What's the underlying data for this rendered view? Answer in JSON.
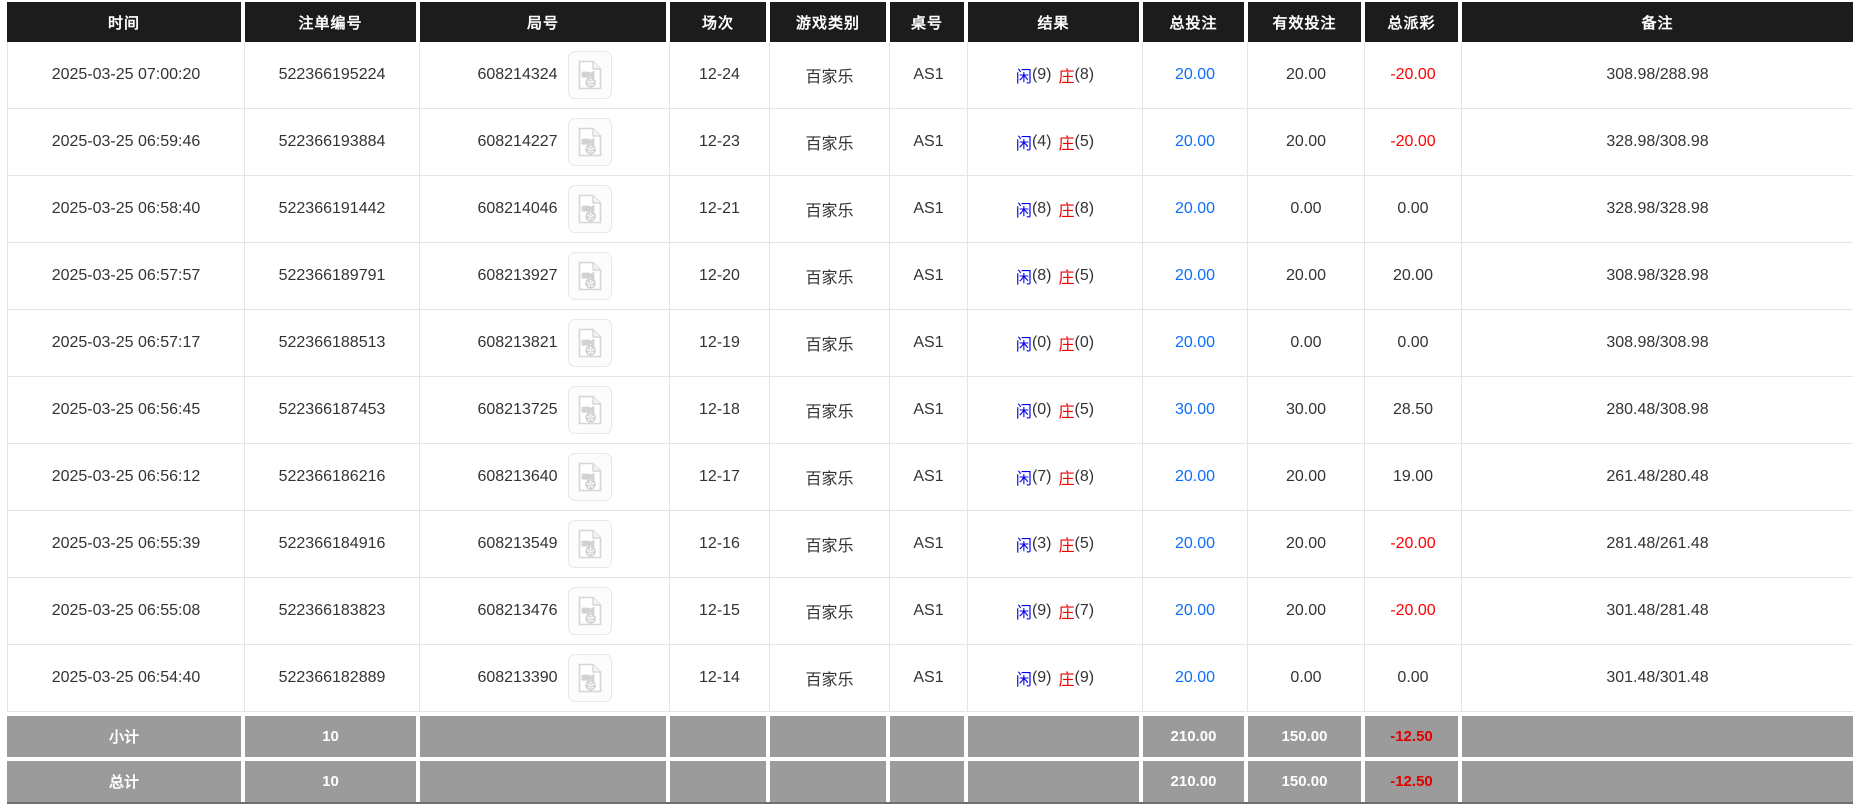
{
  "theme": {
    "header_bg": "#1c1c1c",
    "header_text": "#ffffff",
    "body_text": "#333333",
    "row_border": "#e4e4e4",
    "player_blue": "#0000ee",
    "banker_red": "#ee0000",
    "bet_blue": "#0d6efd",
    "negative_red": "#ff0000",
    "summary_bg": "#9b9b9b",
    "summary_text": "#ffffff",
    "summary_negative": "#e00000"
  },
  "table": {
    "columns": [
      {
        "key": "time",
        "label": "时间"
      },
      {
        "key": "bet_no",
        "label": "注单编号"
      },
      {
        "key": "round_no",
        "label": "局号"
      },
      {
        "key": "session",
        "label": "场次"
      },
      {
        "key": "game",
        "label": "游戏类别"
      },
      {
        "key": "table_no",
        "label": "桌号"
      },
      {
        "key": "result",
        "label": "结果"
      },
      {
        "key": "bet",
        "label": "总投注"
      },
      {
        "key": "valid",
        "label": "有效投注"
      },
      {
        "key": "payout",
        "label": "总派彩"
      },
      {
        "key": "remark",
        "label": "备注"
      }
    ],
    "result_labels": {
      "player": "闲",
      "banker": "庄"
    },
    "icons": {
      "round_video_button": "video-file-icon"
    },
    "rows": [
      {
        "time": "2025-03-25 07:00:20",
        "bet_no": "522366195224",
        "round_no": "608214324",
        "session": "12-24",
        "game": "百家乐",
        "table_no": "AS1",
        "player_score": "(9)",
        "banker_score": "(8)",
        "bet": "20.00",
        "valid": "20.00",
        "payout": "-20.00",
        "remark": "308.98/288.98"
      },
      {
        "time": "2025-03-25 06:59:46",
        "bet_no": "522366193884",
        "round_no": "608214227",
        "session": "12-23",
        "game": "百家乐",
        "table_no": "AS1",
        "player_score": "(4)",
        "banker_score": "(5)",
        "bet": "20.00",
        "valid": "20.00",
        "payout": "-20.00",
        "remark": "328.98/308.98"
      },
      {
        "time": "2025-03-25 06:58:40",
        "bet_no": "522366191442",
        "round_no": "608214046",
        "session": "12-21",
        "game": "百家乐",
        "table_no": "AS1",
        "player_score": "(8)",
        "banker_score": "(8)",
        "bet": "20.00",
        "valid": "0.00",
        "payout": "0.00",
        "remark": "328.98/328.98"
      },
      {
        "time": "2025-03-25 06:57:57",
        "bet_no": "522366189791",
        "round_no": "608213927",
        "session": "12-20",
        "game": "百家乐",
        "table_no": "AS1",
        "player_score": "(8)",
        "banker_score": "(5)",
        "bet": "20.00",
        "valid": "20.00",
        "payout": "20.00",
        "remark": "308.98/328.98"
      },
      {
        "time": "2025-03-25 06:57:17",
        "bet_no": "522366188513",
        "round_no": "608213821",
        "session": "12-19",
        "game": "百家乐",
        "table_no": "AS1",
        "player_score": "(0)",
        "banker_score": "(0)",
        "bet": "20.00",
        "valid": "0.00",
        "payout": "0.00",
        "remark": "308.98/308.98"
      },
      {
        "time": "2025-03-25 06:56:45",
        "bet_no": "522366187453",
        "round_no": "608213725",
        "session": "12-18",
        "game": "百家乐",
        "table_no": "AS1",
        "player_score": "(0)",
        "banker_score": "(5)",
        "bet": "30.00",
        "valid": "30.00",
        "payout": "28.50",
        "remark": "280.48/308.98"
      },
      {
        "time": "2025-03-25 06:56:12",
        "bet_no": "522366186216",
        "round_no": "608213640",
        "session": "12-17",
        "game": "百家乐",
        "table_no": "AS1",
        "player_score": "(7)",
        "banker_score": "(8)",
        "bet": "20.00",
        "valid": "20.00",
        "payout": "19.00",
        "remark": "261.48/280.48"
      },
      {
        "time": "2025-03-25 06:55:39",
        "bet_no": "522366184916",
        "round_no": "608213549",
        "session": "12-16",
        "game": "百家乐",
        "table_no": "AS1",
        "player_score": "(3)",
        "banker_score": "(5)",
        "bet": "20.00",
        "valid": "20.00",
        "payout": "-20.00",
        "remark": "281.48/261.48"
      },
      {
        "time": "2025-03-25 06:55:08",
        "bet_no": "522366183823",
        "round_no": "608213476",
        "session": "12-15",
        "game": "百家乐",
        "table_no": "AS1",
        "player_score": "(9)",
        "banker_score": "(7)",
        "bet": "20.00",
        "valid": "20.00",
        "payout": "-20.00",
        "remark": "301.48/281.48"
      },
      {
        "time": "2025-03-25 06:54:40",
        "bet_no": "522366182889",
        "round_no": "608213390",
        "session": "12-14",
        "game": "百家乐",
        "table_no": "AS1",
        "player_score": "(9)",
        "banker_score": "(9)",
        "bet": "20.00",
        "valid": "0.00",
        "payout": "0.00",
        "remark": "301.48/301.48"
      }
    ],
    "summary_rows": [
      {
        "label": "小计",
        "count": "10",
        "bet": "210.00",
        "valid": "150.00",
        "payout": "-12.50"
      },
      {
        "label": "总计",
        "count": "10",
        "bet": "210.00",
        "valid": "150.00",
        "payout": "-12.50"
      }
    ]
  }
}
